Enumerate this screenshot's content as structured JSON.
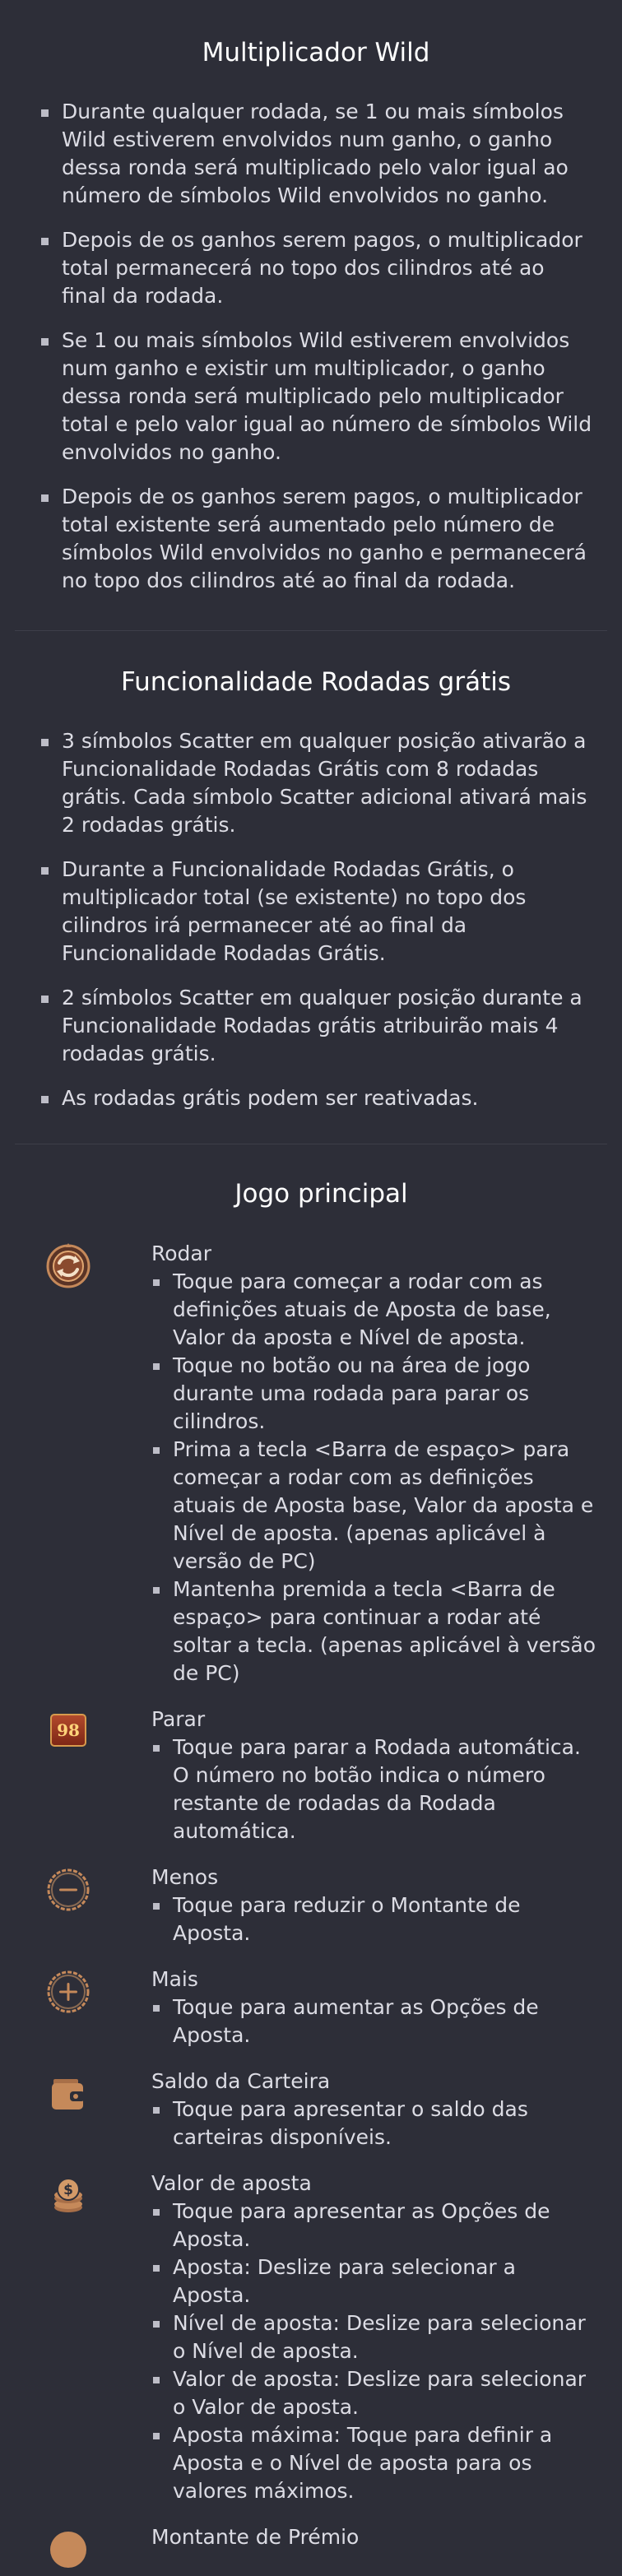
{
  "sections": [
    {
      "title": "Multiplicador Wild",
      "items": [
        "Durante qualquer rodada, se 1 ou mais símbolos Wild estiverem envolvidos num ganho, o ganho dessa ronda será multiplicado pelo valor igual ao número de símbolos Wild envolvidos no ganho.",
        "Depois de os ganhos serem pagos, o multiplicador total permanecerá no topo dos cilindros até ao final da rodada.",
        "Se 1 ou mais símbolos Wild estiverem envolvidos num ganho e existir um multiplicador, o ganho dessa ronda será multiplicado pelo multiplicador total e pelo valor igual ao número de símbolos Wild envolvidos no ganho.",
        "Depois de os ganhos serem pagos, o multiplicador total existente será aumentado pelo número de símbolos Wild envolvidos no ganho e permanecerá no topo dos cilindros até ao final da rodada."
      ]
    },
    {
      "title": "Funcionalidade Rodadas grátis",
      "items": [
        "3 símbolos Scatter em qualquer posição ativarão a Funcionalidade Rodadas Grátis com 8 rodadas grátis. Cada símbolo Scatter adicional ativará mais 2 rodadas grátis.",
        "Durante a Funcionalidade Rodadas Grátis, o multiplicador total (se existente) no topo dos cilindros irá permanecer até ao final da Funcionalidade Rodadas Grátis.",
        "2 símbolos Scatter em qualquer posição durante a Funcionalidade Rodadas grátis atribuirão mais 4 rodadas grátis.",
        "As rodadas grátis podem ser reativadas."
      ]
    }
  ],
  "main_game": {
    "title": "Jogo principal",
    "entries": [
      {
        "icon": "spin-icon",
        "title": "Rodar",
        "items": [
          "Toque para começar a rodar com as definições atuais de Aposta de base, Valor da aposta e Nível de aposta.",
          "Toque no botão ou na área de jogo durante uma rodada para parar os cilindros.",
          "Prima a tecla <Barra de espaço> para começar a rodar com as definições atuais de Aposta base, Valor da aposta e Nível de aposta. (apenas aplicável à versão de PC)",
          "Mantenha premida a tecla <Barra de espaço> para continuar a rodar até soltar a tecla. (apenas aplicável à versão de PC)"
        ]
      },
      {
        "icon": "autospin-counter-icon",
        "badge": "98",
        "title": "Parar",
        "items": [
          "Toque para parar a Rodada automática. O número no botão indica o número restante de rodadas da Rodada automática."
        ]
      },
      {
        "icon": "minus-icon",
        "title": "Menos",
        "items": [
          "Toque para reduzir o Montante de Aposta."
        ]
      },
      {
        "icon": "plus-icon",
        "title": "Mais",
        "items": [
          "Toque para aumentar as Opções de Aposta."
        ]
      },
      {
        "icon": "wallet-icon",
        "title": "Saldo da Carteira",
        "items": [
          "Toque para apresentar o saldo das carteiras disponíveis."
        ]
      },
      {
        "icon": "coins-icon",
        "title": "Valor de aposta",
        "items": [
          "Toque para apresentar as Opções de Aposta.",
          "Aposta: Deslize para selecionar a Aposta.",
          "Nível de aposta: Deslize para selecionar o Nível de aposta.",
          "Valor de aposta: Deslize para selecionar o Valor de aposta.",
          "Aposta máxima: Toque para definir a Aposta e o Nível de aposta para os valores máximos."
        ]
      },
      {
        "icon": "bonus-amount-icon",
        "title": "Montante de Prémio",
        "items": []
      }
    ]
  },
  "colors": {
    "background": "#2d2e38",
    "text": "#dcdce4",
    "icon_accent": "#c5895a"
  }
}
